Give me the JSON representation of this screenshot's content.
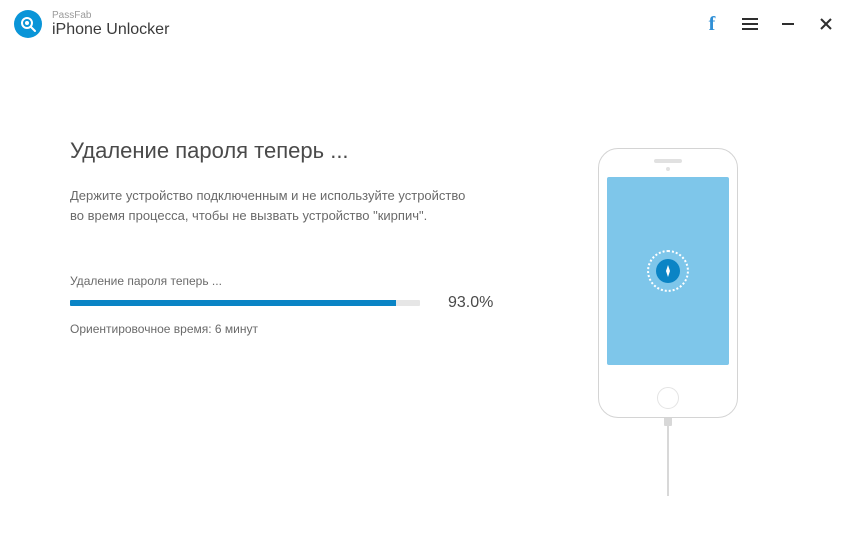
{
  "header": {
    "brand": "PassFab",
    "app_name": "iPhone Unlocker"
  },
  "main": {
    "heading": "Удаление пароля теперь ...",
    "description": "Держите устройство подключенным и не используйте устройство во время процесса, чтобы не вызвать устройство \"кирпич\".",
    "progress_label": "Удаление пароля теперь ...",
    "progress_pct_value": 93.0,
    "progress_pct_text": "93.0%",
    "progress_fill_style": "width:93%",
    "eta_text": "Ориентировочное время: 6 минут"
  }
}
